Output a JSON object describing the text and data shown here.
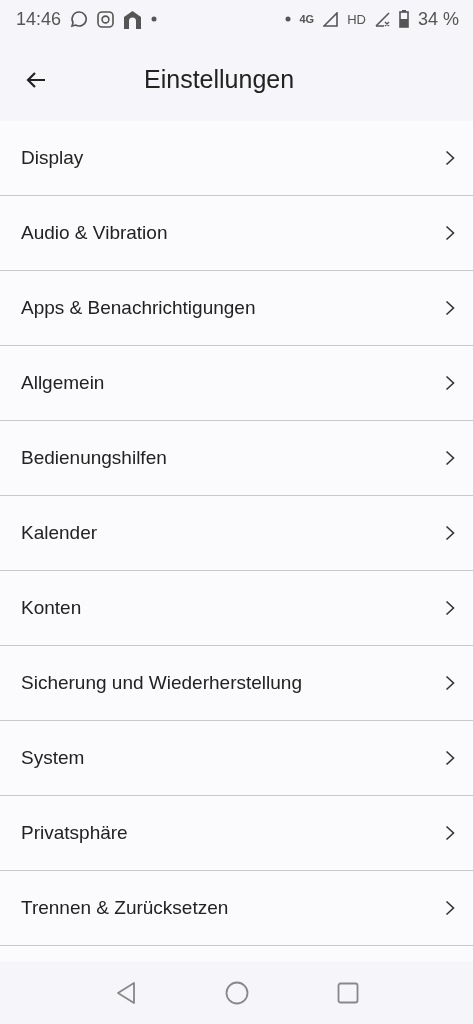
{
  "status_bar": {
    "time": "14:46",
    "network": "4G",
    "hd": "HD",
    "battery": "34 %"
  },
  "header": {
    "title": "Einstellungen"
  },
  "items": [
    {
      "label": "Display"
    },
    {
      "label": "Audio & Vibration"
    },
    {
      "label": "Apps & Benachrichtigungen"
    },
    {
      "label": "Allgemein"
    },
    {
      "label": "Bedienungshilfen"
    },
    {
      "label": "Kalender"
    },
    {
      "label": "Konten"
    },
    {
      "label": "Sicherung und Wiederherstellung"
    },
    {
      "label": "System"
    },
    {
      "label": "Privatsphäre"
    },
    {
      "label": "Trennen & Zurücksetzen"
    }
  ]
}
